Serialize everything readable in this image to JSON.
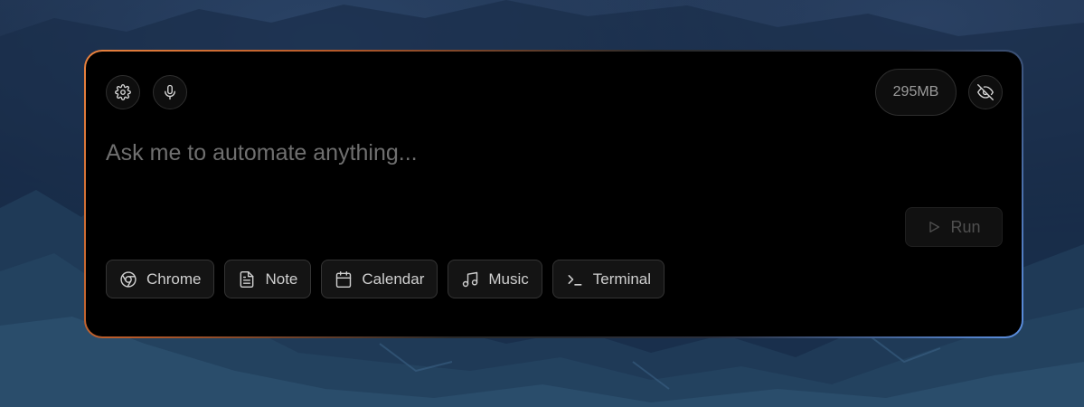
{
  "toolbar": {
    "settings_icon": "gear-icon",
    "mic_icon": "microphone-icon",
    "memory_usage": "295MB",
    "visibility_icon": "eye-off-icon"
  },
  "prompt": {
    "placeholder": "Ask me to automate anything...",
    "value": ""
  },
  "run_button": {
    "label": "Run",
    "icon": "play-icon"
  },
  "apps": [
    {
      "label": "Chrome",
      "icon": "chrome-icon"
    },
    {
      "label": "Note",
      "icon": "document-icon"
    },
    {
      "label": "Calendar",
      "icon": "calendar-icon"
    },
    {
      "label": "Music",
      "icon": "music-note-icon"
    },
    {
      "label": "Terminal",
      "icon": "terminal-icon"
    }
  ],
  "colors": {
    "border_gradient_start": "#e9823e",
    "border_gradient_end": "#5b8fe0",
    "panel_background": "#000000"
  }
}
